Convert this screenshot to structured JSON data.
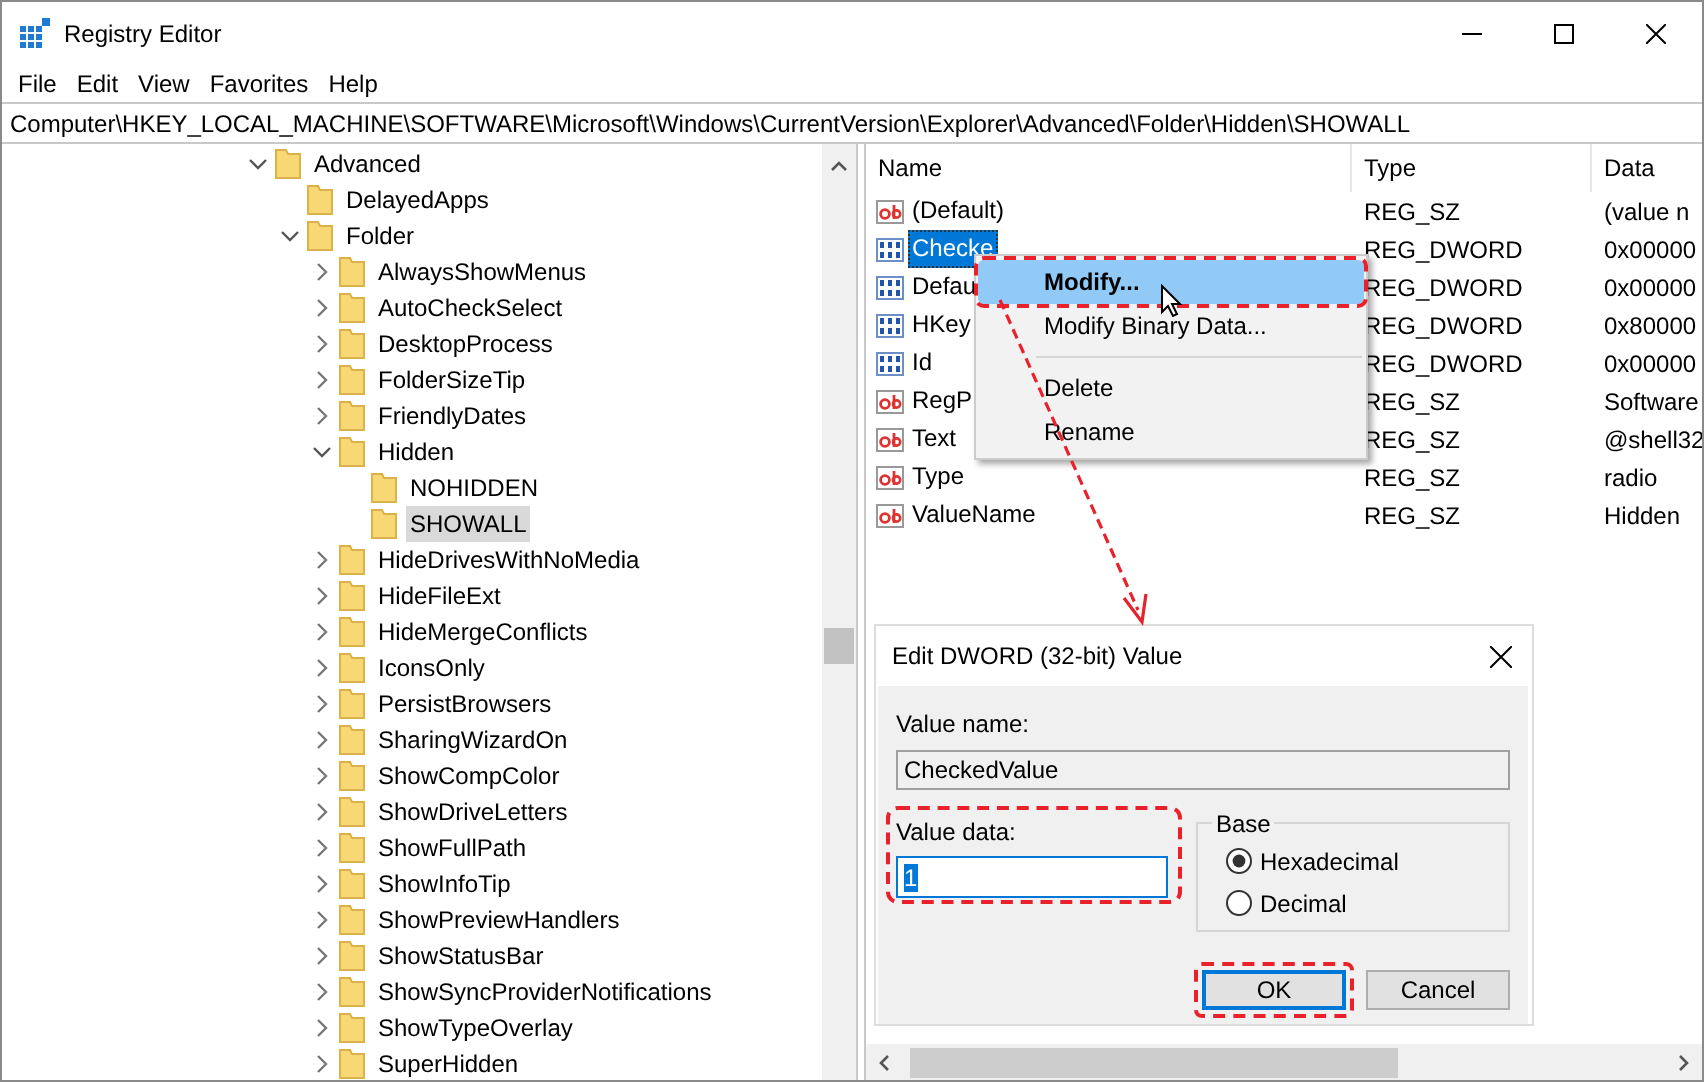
{
  "window": {
    "title": "Registry Editor"
  },
  "menu": [
    "File",
    "Edit",
    "View",
    "Favorites",
    "Help"
  ],
  "address": "Computer\\HKEY_LOCAL_MACHINE\\SOFTWARE\\Microsoft\\Windows\\CurrentVersion\\Explorer\\Advanced\\Folder\\Hidden\\SHOWALL",
  "tree": [
    {
      "label": "Advanced",
      "expanded": true,
      "selected": false,
      "children": [
        {
          "label": "DelayedApps",
          "selected": false
        },
        {
          "label": "Folder",
          "expanded": true,
          "selected": false,
          "children": [
            {
              "label": "AlwaysShowMenus",
              "expanded": false,
              "selected": false
            },
            {
              "label": "AutoCheckSelect",
              "expanded": false,
              "selected": false
            },
            {
              "label": "DesktopProcess",
              "expanded": false,
              "selected": false
            },
            {
              "label": "FolderSizeTip",
              "expanded": false,
              "selected": false
            },
            {
              "label": "FriendlyDates",
              "expanded": false,
              "selected": false
            },
            {
              "label": "Hidden",
              "expanded": true,
              "selected": false,
              "children": [
                {
                  "label": "NOHIDDEN",
                  "selected": false
                },
                {
                  "label": "SHOWALL",
                  "selected": true
                }
              ]
            },
            {
              "label": "HideDrivesWithNoMedia",
              "expanded": false,
              "selected": false
            },
            {
              "label": "HideFileExt",
              "expanded": false,
              "selected": false
            },
            {
              "label": "HideMergeConflicts",
              "expanded": false,
              "selected": false
            },
            {
              "label": "IconsOnly",
              "expanded": false,
              "selected": false
            },
            {
              "label": "PersistBrowsers",
              "expanded": false,
              "selected": false
            },
            {
              "label": "SharingWizardOn",
              "expanded": false,
              "selected": false
            },
            {
              "label": "ShowCompColor",
              "expanded": false,
              "selected": false
            },
            {
              "label": "ShowDriveLetters",
              "expanded": false,
              "selected": false
            },
            {
              "label": "ShowFullPath",
              "expanded": false,
              "selected": false
            },
            {
              "label": "ShowInfoTip",
              "expanded": false,
              "selected": false
            },
            {
              "label": "ShowPreviewHandlers",
              "expanded": false,
              "selected": false
            },
            {
              "label": "ShowStatusBar",
              "expanded": false,
              "selected": false
            },
            {
              "label": "ShowSyncProviderNotifications",
              "expanded": false,
              "selected": false
            },
            {
              "label": "ShowTypeOverlay",
              "expanded": false,
              "selected": false
            },
            {
              "label": "SuperHidden",
              "expanded": false,
              "selected": false
            }
          ]
        }
      ]
    }
  ],
  "table": {
    "columns": [
      "Name",
      "Type",
      "Data"
    ],
    "rows": [
      {
        "kind": "string",
        "name": "(Default)",
        "type": "REG_SZ",
        "data": "(value n",
        "selected": false
      },
      {
        "kind": "dword",
        "name": "Checke",
        "type": "REG_DWORD",
        "data": "0x00000",
        "selected": true
      },
      {
        "kind": "dword",
        "name": "Defau",
        "type": "REG_DWORD",
        "data": "0x00000",
        "selected": false
      },
      {
        "kind": "dword",
        "name": "HKey",
        "type": "REG_DWORD",
        "data": "0x80000",
        "selected": false
      },
      {
        "kind": "dword",
        "name": "Id",
        "type": "REG_DWORD",
        "data": "0x00000",
        "selected": false
      },
      {
        "kind": "string",
        "name": "RegP",
        "type": "REG_SZ",
        "data": "Software",
        "selected": false
      },
      {
        "kind": "string",
        "name": "Text",
        "type": "REG_SZ",
        "data": "@shell32",
        "selected": false
      },
      {
        "kind": "string",
        "name": "Type",
        "type": "REG_SZ",
        "data": "radio",
        "selected": false
      },
      {
        "kind": "string",
        "name": "ValueName",
        "type": "REG_SZ",
        "data": "Hidden",
        "selected": false
      }
    ]
  },
  "context_menu": {
    "items": [
      {
        "kind": "item",
        "label": "Modify...",
        "default": true,
        "selected": true,
        "annotated": true
      },
      {
        "kind": "item",
        "label": "Modify Binary Data...",
        "default": false,
        "selected": false,
        "annotated": false
      },
      {
        "kind": "separator"
      },
      {
        "kind": "item",
        "label": "Delete",
        "default": false,
        "selected": false,
        "annotated": false
      },
      {
        "kind": "item",
        "label": "Rename",
        "default": false,
        "selected": false,
        "annotated": false
      }
    ]
  },
  "dialog": {
    "title": "Edit DWORD (32-bit) Value",
    "value_name_label": "Value name:",
    "value_name": "CheckedValue",
    "value_data_label": "Value data:",
    "value_data": "1",
    "value_data_annotated": true,
    "base_label": "Base",
    "base_options": [
      {
        "label": "Hexadecimal",
        "selected": true
      },
      {
        "label": "Decimal",
        "selected": false
      }
    ],
    "buttons": [
      {
        "label": "OK",
        "focused": true,
        "annotated": true
      },
      {
        "label": "Cancel",
        "focused": false,
        "annotated": false
      }
    ]
  }
}
